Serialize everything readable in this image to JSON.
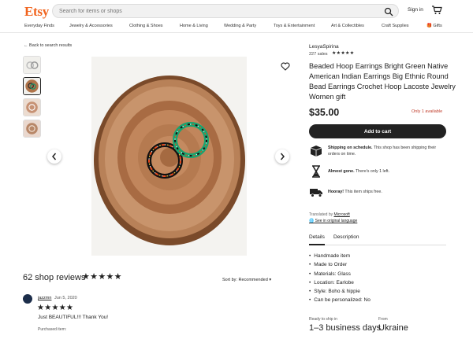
{
  "header": {
    "logo": "Etsy",
    "search_placeholder": "Search for items or shops",
    "signin": "Sign in"
  },
  "nav": {
    "categories": [
      "Everyday Finds",
      "Jewelry & Accessories",
      "Clothing & Shoes",
      "Home & Living",
      "Wedding & Party",
      "Toys & Entertainment",
      "Art & Collectibles",
      "Craft Supplies",
      "Gifts"
    ]
  },
  "back_link": "Back to search results",
  "listing": {
    "seller": "LesyaSpirina",
    "sales": "227 sales",
    "seller_stars": "★★★★★",
    "title": "Beaded Hoop Earrings Bright Green Native American Indian Earrings Big Ethnic Round Bead Earrings Crochet Hoop Lacoste Jewelry Women gift",
    "price": "$35.00",
    "availability": "Only 1 available",
    "add_to_cart": "Add to cart"
  },
  "features": [
    {
      "icon": "truck-box-icon",
      "bold": "Shipping on schedule.",
      "text": " This shop has been shipping their orders on time."
    },
    {
      "icon": "hourglass-icon",
      "bold": "Almost gone.",
      "text": " There's only 1 left."
    },
    {
      "icon": "delivery-truck-icon",
      "bold": "Hooray!",
      "text": " This item ships free."
    }
  ],
  "translation": {
    "prefix": "Translated by ",
    "provider": "Microsoft",
    "original": "See in original language"
  },
  "tabs": [
    "Details",
    "Description"
  ],
  "details": [
    "Handmade item",
    "Made to Order",
    "Materials: Glass",
    "Location: Earlobe",
    "Style: Boho & hippie",
    "Can be personalized: No"
  ],
  "shipping": {
    "ready_label": "Ready to ship in",
    "ready_value": "1–3 business days",
    "from_label": "From",
    "from_value": "Ukraine"
  },
  "reviews": {
    "heading": "62 shop reviews",
    "stars": "★★★★★",
    "sort": "Sort by: Recommended",
    "items": [
      {
        "user": "jazzmn",
        "date": "Jun 5, 2020",
        "stars": "★★★★★",
        "text": "Just BEAUTIFUL!!! Thank You!",
        "purchased": "Purchased item:"
      }
    ]
  },
  "colors": {
    "brand": "#f1641e",
    "availability": "#c13d2b",
    "button": "#222222"
  }
}
